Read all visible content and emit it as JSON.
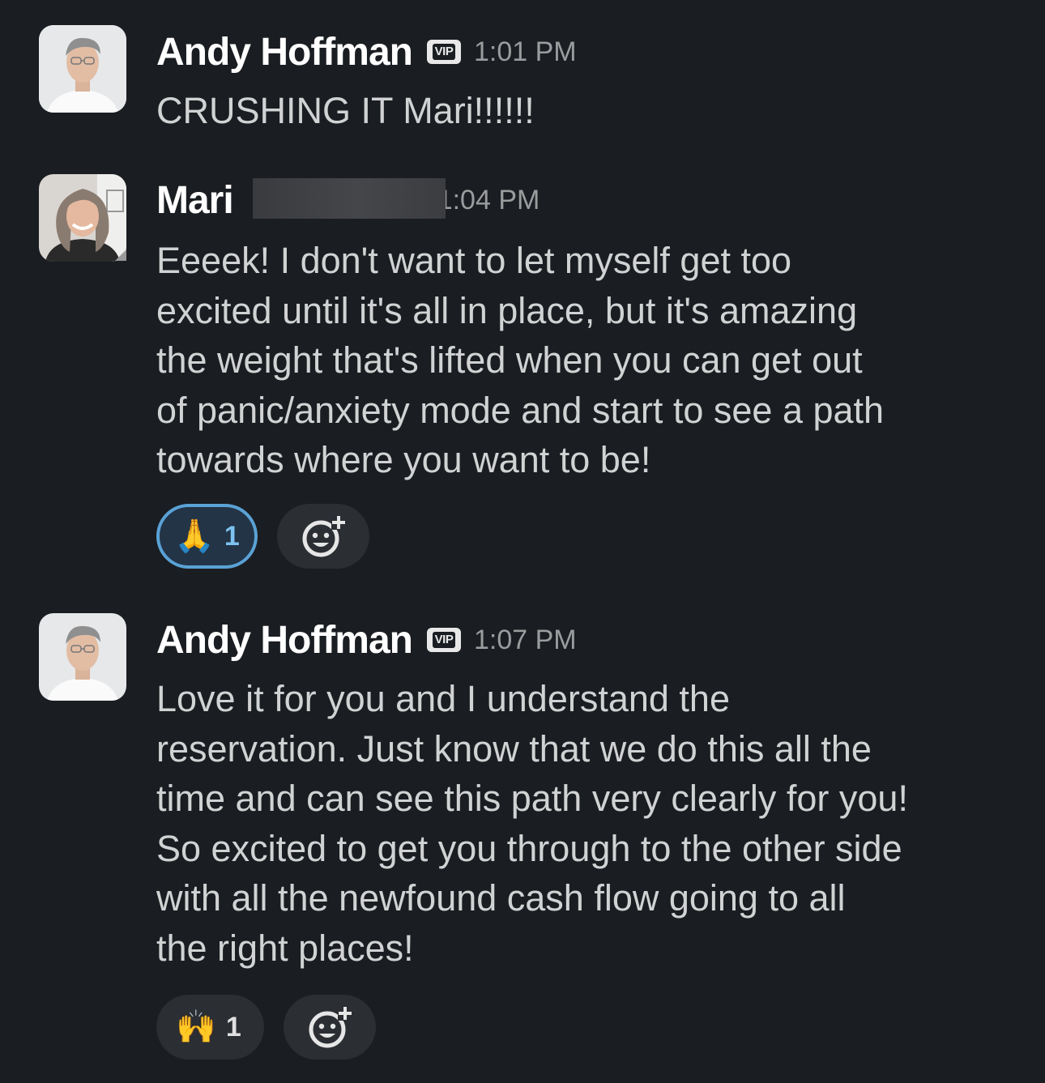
{
  "messages": [
    {
      "author": "Andy Hoffman",
      "badge": "VIP",
      "time": "1:01 PM",
      "text": "CRUSHING IT Mari!!!!!!",
      "avatar": "andy-avatar"
    },
    {
      "author": "Mari",
      "time": "1:04 PM",
      "text": "Eeeek! I don't want to let myself get too\nexcited until it's all in place, but it's amazing\nthe weight that's lifted when you can get out\nof panic/anxiety mode and start to see a path\ntowards where you want to be!",
      "avatar": "mari-avatar",
      "reactions": [
        {
          "emoji": "🙏",
          "icon": "folded-hands-icon",
          "count": "1",
          "active": true
        }
      ]
    },
    {
      "author": "Andy Hoffman",
      "badge": "VIP",
      "time": "1:07 PM",
      "text": "Love it for you and I understand the\nreservation. Just know that we do this all the\ntime and can see this path very clearly for you!\nSo excited to get you through to the other side\nwith all the newfound cash flow going to all\nthe right places!",
      "avatar": "andy-avatar",
      "reactions": [
        {
          "emoji": "🙌",
          "icon": "raising-hands-icon",
          "count": "1",
          "active": false
        }
      ]
    }
  ],
  "colors": {
    "background": "#1a1d21",
    "reaction_active_border": "#5aa2d6",
    "reaction_bg": "#2b2e33"
  }
}
